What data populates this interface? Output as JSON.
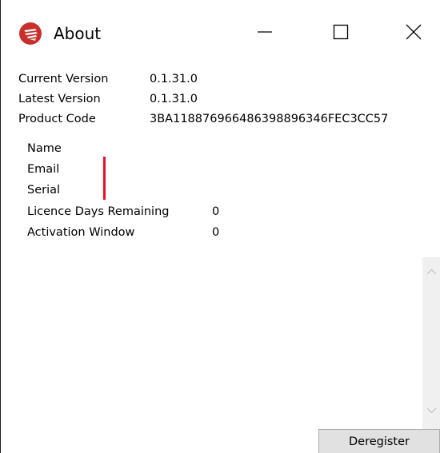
{
  "window": {
    "title": "About",
    "icon": "app-logo-icon"
  },
  "titlebar_buttons": {
    "minimize_icon": "minimize-icon",
    "maximize_icon": "maximize-icon",
    "close_icon": "close-icon"
  },
  "info": [
    {
      "label": "Current Version",
      "value": "0.1.31.0"
    },
    {
      "label": "Latest Version",
      "value": "0.1.31.0"
    },
    {
      "label": "Product Code",
      "value": "3BA118876966486398896346FEC3CC57"
    }
  ],
  "licence": {
    "name_label": "Name",
    "email_label": "Email",
    "serial_label": "Serial",
    "days_label": "Licence Days Remaining",
    "days_value": "0",
    "window_label": "Activation Window",
    "window_value": "0"
  },
  "colors": {
    "accent_red": "#e81123",
    "icon_red": "#c9302c"
  },
  "actions": {
    "deregister_label": "Deregister"
  }
}
